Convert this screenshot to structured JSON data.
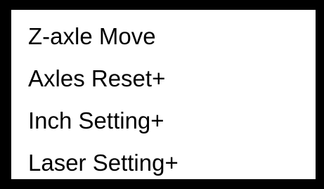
{
  "menu": {
    "items": [
      {
        "label": "Z-axle Move"
      },
      {
        "label": "Axles Reset+"
      },
      {
        "label": "Inch Setting+"
      },
      {
        "label": "Laser Setting+"
      }
    ]
  },
  "colors": {
    "frame": "#000000",
    "background": "#ffffff",
    "text": "#000000"
  }
}
